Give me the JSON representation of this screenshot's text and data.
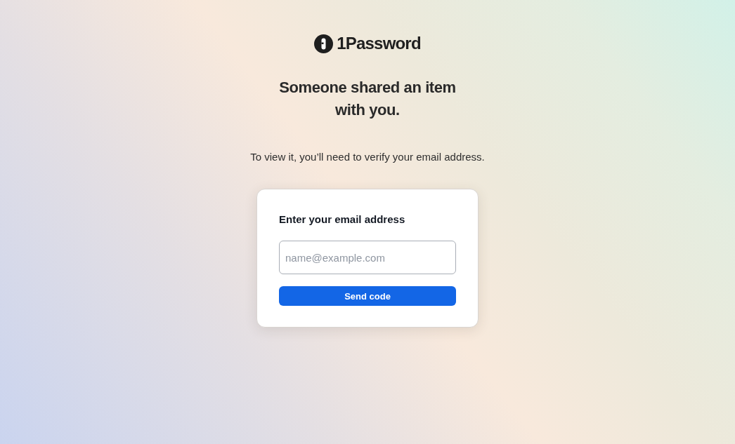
{
  "logo": {
    "text": "1Password"
  },
  "heading": "Someone shared an item with you.",
  "subtitle": "To view it, you’ll need to verify your email address.",
  "form": {
    "label": "Enter your email address",
    "email_field": {
      "placeholder": "name@example.com"
    },
    "submit_button": "Send code"
  }
}
